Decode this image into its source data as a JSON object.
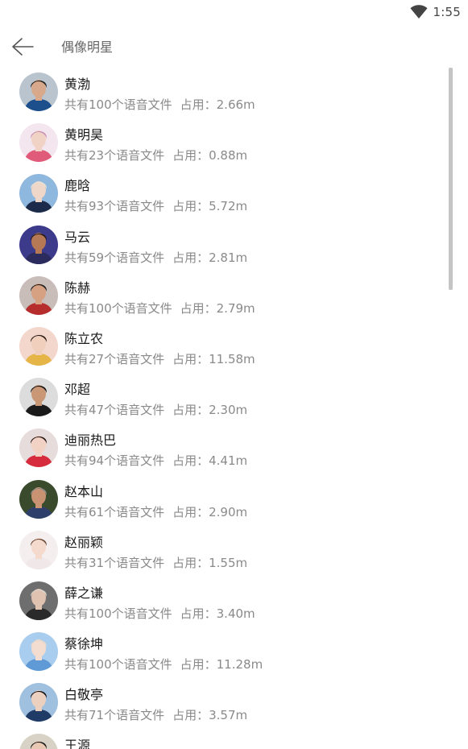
{
  "status_bar": {
    "time": "1:55",
    "wifi_icon": "wifi-icon"
  },
  "app_bar": {
    "back_icon": "back-arrow-icon",
    "title": "偶像明星"
  },
  "list": {
    "items": [
      {
        "name": "黄渤",
        "file_info": "共有100个语音文件",
        "size_label": "占用：2.66m",
        "avatar": "avatar-黄渤",
        "colors": {
          "bg": "#b9c4cf",
          "hair": "#1e1e1e",
          "skin": "#d7a98a",
          "cloth": "#1c4f8c"
        }
      },
      {
        "name": "黄明昊",
        "file_info": "共有23个语音文件",
        "size_label": "占用：0.88m",
        "avatar": "avatar-黄明昊",
        "colors": {
          "bg": "#f3e6ee",
          "hair": "#c98fb6",
          "skin": "#f1d3c5",
          "cloth": "#e05a7a"
        }
      },
      {
        "name": "鹿晗",
        "file_info": "共有93个语音文件",
        "size_label": "占用：5.72m",
        "avatar": "avatar-鹿晗",
        "colors": {
          "bg": "#8fb8df",
          "hair": "#e8e2d2",
          "skin": "#eed6c8",
          "cloth": "#1d2b4a"
        }
      },
      {
        "name": "马云",
        "file_info": "共有59个语音文件",
        "size_label": "占用：2.81m",
        "avatar": "avatar-马云",
        "colors": {
          "bg": "#3c3a8a",
          "hair": "#2a1a12",
          "skin": "#b57a55",
          "cloth": "#2b2b5e"
        }
      },
      {
        "name": "陈赫",
        "file_info": "共有100个语音文件",
        "size_label": "占用：2.79m",
        "avatar": "avatar-陈赫",
        "colors": {
          "bg": "#c9bdb9",
          "hair": "#1a1a1a",
          "skin": "#d6a083",
          "cloth": "#b52d2d"
        }
      },
      {
        "name": "陈立农",
        "file_info": "共有27个语音文件",
        "size_label": "占用：11.58m",
        "avatar": "avatar-陈立农",
        "colors": {
          "bg": "#f3d6cc",
          "hair": "#2a1d18",
          "skin": "#f0d0bd",
          "cloth": "#e6b548"
        }
      },
      {
        "name": "邓超",
        "file_info": "共有47个语音文件",
        "size_label": "占用：2.30m",
        "avatar": "avatar-邓超",
        "colors": {
          "bg": "#dcdcdc",
          "hair": "#111111",
          "skin": "#c99676",
          "cloth": "#1a1a1a"
        }
      },
      {
        "name": "迪丽热巴",
        "file_info": "共有94个语音文件",
        "size_label": "占用：4.41m",
        "avatar": "avatar-迪丽热巴",
        "colors": {
          "bg": "#e7dcdc",
          "hair": "#2a1a14",
          "skin": "#f2d2c4",
          "cloth": "#d62b3c"
        }
      },
      {
        "name": "赵本山",
        "file_info": "共有61个语音文件",
        "size_label": "占用：2.90m",
        "avatar": "avatar-赵本山",
        "colors": {
          "bg": "#3a4a2c",
          "hair": "#8a8a8a",
          "skin": "#c99273",
          "cloth": "#2d3f6a"
        }
      },
      {
        "name": "赵丽颖",
        "file_info": "共有31个语音文件",
        "size_label": "占用：1.55m",
        "avatar": "avatar-赵丽颖",
        "colors": {
          "bg": "#f5eeee",
          "hair": "#6b4a35",
          "skin": "#f4d9cd",
          "cloth": "#f0e8e8"
        }
      },
      {
        "name": "薛之谦",
        "file_info": "共有100个语音文件",
        "size_label": "占用：3.40m",
        "avatar": "avatar-薛之谦",
        "colors": {
          "bg": "#6e6e6e",
          "hair": "#d9d6cf",
          "skin": "#e0c2b0",
          "cloth": "#2a2a2a"
        }
      },
      {
        "name": "蔡徐坤",
        "file_info": "共有100个语音文件",
        "size_label": "占用：11.28m",
        "avatar": "avatar-蔡徐坤",
        "colors": {
          "bg": "#a8cdef",
          "hair": "#e8d8c8",
          "skin": "#f3dcd0",
          "cloth": "#5f9ad6"
        }
      },
      {
        "name": "白敬亭",
        "file_info": "共有71个语音文件",
        "size_label": "占用：3.57m",
        "avatar": "avatar-白敬亭",
        "colors": {
          "bg": "#9fc0de",
          "hair": "#141414",
          "skin": "#ecd0bf",
          "cloth": "#1f3b66"
        }
      },
      {
        "name": "王源",
        "file_info": "",
        "size_label": "",
        "avatar": "avatar-王源",
        "colors": {
          "bg": "#d8d2c6",
          "hair": "#1a1a1a",
          "skin": "#e8c8b3",
          "cloth": "#2a2a2a"
        }
      }
    ]
  }
}
